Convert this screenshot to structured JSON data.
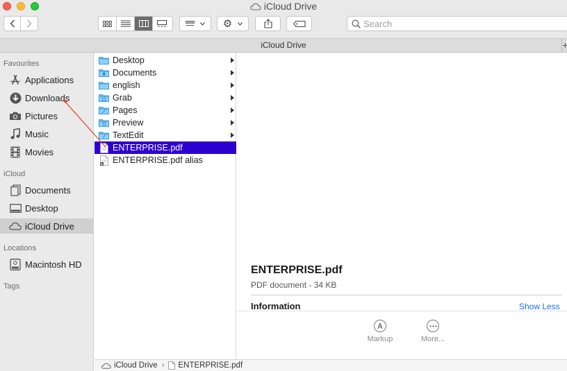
{
  "window": {
    "title": "iCloud Drive"
  },
  "toolbar": {
    "back_icon": "chevron-left-icon",
    "forward_icon": "chevron-right-icon",
    "view_modes": [
      "icon-view",
      "list-view",
      "column-view",
      "gallery-view"
    ],
    "active_view": "column-view",
    "group_icon": "group-by-icon",
    "action_icon": "gear-icon",
    "share_icon": "share-icon",
    "tag_icon": "tag-icon",
    "search_placeholder": "Search"
  },
  "path_title": "iCloud Drive",
  "sidebar": {
    "sections": [
      {
        "header": "Favourites",
        "items": [
          {
            "label": "Applications",
            "icon": "applications-icon"
          },
          {
            "label": "Downloads",
            "icon": "downloads-icon"
          },
          {
            "label": "Pictures",
            "icon": "camera-icon"
          },
          {
            "label": "Music",
            "icon": "music-note-icon"
          },
          {
            "label": "Movies",
            "icon": "film-icon"
          }
        ]
      },
      {
        "header": "iCloud",
        "items": [
          {
            "label": "Documents",
            "icon": "document-icon"
          },
          {
            "label": "Desktop",
            "icon": "desktop-icon"
          },
          {
            "label": "iCloud Drive",
            "icon": "cloud-icon",
            "selected": true
          }
        ]
      },
      {
        "header": "Locations",
        "items": [
          {
            "label": "Macintosh HD",
            "icon": "hard-drive-icon"
          }
        ]
      },
      {
        "header": "Tags",
        "items": []
      }
    ]
  },
  "column": {
    "rows": [
      {
        "label": "Desktop",
        "icon": "folder-icon",
        "has_children": true
      },
      {
        "label": "Documents",
        "icon": "folder-icon",
        "has_children": true
      },
      {
        "label": "english",
        "icon": "folder-icon",
        "has_children": true
      },
      {
        "label": "Grab",
        "icon": "folder-icon",
        "has_children": true
      },
      {
        "label": "Pages",
        "icon": "folder-icon",
        "has_children": true
      },
      {
        "label": "Preview",
        "icon": "folder-icon",
        "has_children": true
      },
      {
        "label": "TextEdit",
        "icon": "folder-icon",
        "has_children": true
      },
      {
        "label": "ENTERPRISE.pdf",
        "icon": "pdf-file-icon",
        "selected": true
      },
      {
        "label": "ENTERPRISE.pdf alias",
        "icon": "alias-file-icon"
      }
    ]
  },
  "preview": {
    "file_name": "ENTERPRISE.pdf",
    "kind": "PDF document - 34 KB",
    "info_label": "Information",
    "show_less": "Show Less",
    "actions": [
      {
        "label": "Markup",
        "icon": "markup-icon"
      },
      {
        "label": "More...",
        "icon": "more-icon"
      }
    ]
  },
  "pathbar": {
    "segments": [
      {
        "label": "iCloud Drive",
        "icon": "cloud-icon"
      },
      {
        "label": "ENTERPRISE.pdf",
        "icon": "pdf-file-icon"
      }
    ],
    "separator": "›"
  },
  "colors": {
    "selection": "#2e00d0",
    "link": "#1b6ee0",
    "annotation_arrow": "#e8391f"
  }
}
